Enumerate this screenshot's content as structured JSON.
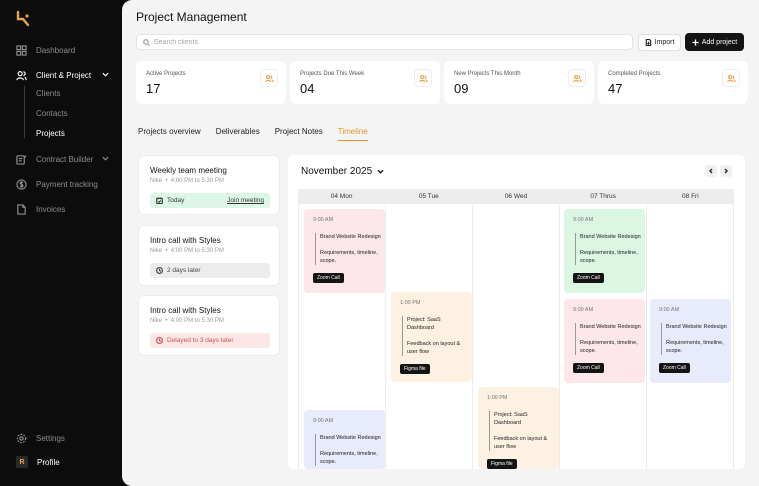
{
  "sidebar": {
    "items": [
      {
        "label": "Dashboard"
      },
      {
        "label": "Client & Project"
      },
      {
        "label": "Contract Builder"
      },
      {
        "label": "Payment tracking"
      },
      {
        "label": "Invoices"
      }
    ],
    "sub_items": [
      {
        "label": "Clients"
      },
      {
        "label": "Contacts"
      },
      {
        "label": "Projects"
      }
    ],
    "settings_label": "Settings",
    "profile_label": "Profile",
    "profile_initial": "R"
  },
  "header": {
    "title": "Project Management",
    "search_placeholder": "Search clients",
    "import_label": "Import",
    "add_label": "Add project"
  },
  "stats": [
    {
      "label": "Active Projects",
      "value": "17"
    },
    {
      "label": "Projects Due This Week",
      "value": "04"
    },
    {
      "label": "New Projects This Month",
      "value": "09"
    },
    {
      "label": "Completed Projects",
      "value": "47"
    }
  ],
  "tabs": [
    {
      "label": "Projects overview"
    },
    {
      "label": "Deliverables"
    },
    {
      "label": "Project Notes"
    },
    {
      "label": "Timeline"
    }
  ],
  "meetings": [
    {
      "title": "Weekly team meeting",
      "client": "Nike",
      "time": "4:00 PM to 5:30 PM",
      "status": "Today",
      "action": "Join meeting"
    },
    {
      "title": "Intro call with Styles",
      "client": "Nike",
      "time": "4:00 PM to 5:30 PM",
      "status": "2 days later"
    },
    {
      "title": "Intro call with Styles",
      "client": "Nike",
      "time": "4:00 PM to 5:30 PM",
      "status": "Delayed to 3 days later"
    }
  ],
  "calendar": {
    "month": "November 2025",
    "days": [
      "04 Mon",
      "05 Tue",
      "06 Wed",
      "07 Thrus",
      "08 Fri"
    ],
    "events": [
      {
        "time": "9:00 AM",
        "line1": "Brand Website Redesign",
        "line2": "Requirements, timeline, scope.",
        "button": "Zoom Call"
      },
      {
        "time": "9:00 AM",
        "line1": "Brand Website Redesign",
        "line2": "Requirements, timeline, scope.",
        "button": ""
      },
      {
        "time": "1:00 PM",
        "line1": "Project: SaaS Dashboard",
        "line2": "Feedback on layout & user flow",
        "button": "Figma file"
      },
      {
        "time": "1:00 PM",
        "line1": "Project: SaaS Dashboard",
        "line2": "Feedback on layout & user flow",
        "button": "Figma file"
      },
      {
        "time": "9:00 AM",
        "line1": "Brand Website Redesign",
        "line2": "Requirements, timeline, scope.",
        "button": "Zoom Call"
      },
      {
        "time": "9:00 AM",
        "line1": "Brand Website Redesign",
        "line2": "Requirements, timeline, scope.",
        "button": "Zoom Call"
      },
      {
        "time": "9:00 AM",
        "line1": "Brand Website Redesign",
        "line2": "Requirements, timeline, scope.",
        "button": "Zoom Call"
      }
    ]
  },
  "colors": {
    "accent": "#e0952f",
    "dark": "#141414"
  }
}
